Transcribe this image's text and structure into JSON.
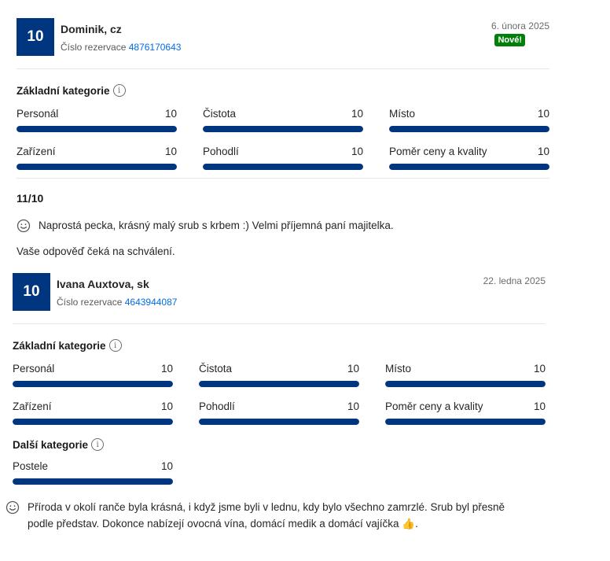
{
  "reviews": [
    {
      "score": "10",
      "name": "Dominik, cz",
      "reservation_label": "Číslo rezervace",
      "reservation_number": "4876170643",
      "date": "6. února 2025",
      "badge": "Nové!",
      "basic_title": "Základní kategorie",
      "categories": [
        {
          "label": "Personál",
          "value": "10",
          "fraction": 1.0
        },
        {
          "label": "Čistota",
          "value": "10",
          "fraction": 1.0
        },
        {
          "label": "Místo",
          "value": "10",
          "fraction": 1.0
        },
        {
          "label": "Zařízení",
          "value": "10",
          "fraction": 1.0
        },
        {
          "label": "Pohodlí",
          "value": "10",
          "fraction": 1.0
        },
        {
          "label": "Poměr ceny a kvality",
          "value": "10",
          "fraction": 1.0
        }
      ],
      "title": "11/10",
      "comment": "Naprostá pecka, krásný malý srub s krbem :) Velmi příjemná paní majitelka.",
      "reply_status": "Vaše odpověď čeká na schválení."
    },
    {
      "score": "10",
      "name": "Ivana Auxtova, sk",
      "reservation_label": "Číslo rezervace",
      "reservation_number": "4643944087",
      "date": "22. ledna 2025",
      "basic_title": "Základní kategorie",
      "categories": [
        {
          "label": "Personál",
          "value": "10",
          "fraction": 1.0
        },
        {
          "label": "Čistota",
          "value": "10",
          "fraction": 1.0
        },
        {
          "label": "Místo",
          "value": "10",
          "fraction": 1.0
        },
        {
          "label": "Zařízení",
          "value": "10",
          "fraction": 1.0
        },
        {
          "label": "Pohodlí",
          "value": "10",
          "fraction": 1.0
        },
        {
          "label": "Poměr ceny a kvality",
          "value": "10",
          "fraction": 1.0
        }
      ],
      "extra_title": "Další kategorie",
      "extra_categories": [
        {
          "label": "Postele",
          "value": "10",
          "fraction": 1.0
        }
      ],
      "comment_line1": "Příroda v okolí ranče byla krásná, i když jsme byli v lednu, kdy bylo všechno zamrzlé. Srub byl přesně",
      "comment_line2": "podle představ. Dokonce nabízejí ovocná vína, domácí medik a domácí vajíčka 👍."
    }
  ],
  "icons": {
    "info": "info-icon",
    "smile": "smile-icon"
  },
  "colors": {
    "accent": "#003580",
    "new_badge": "#008009",
    "link": "#006ce4"
  }
}
